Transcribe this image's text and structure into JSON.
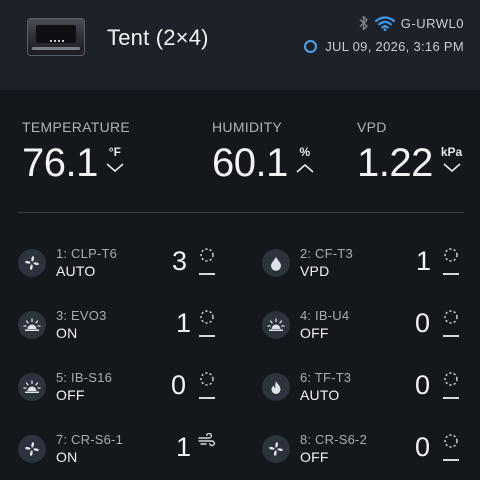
{
  "header": {
    "title": "Tent (2×4)",
    "network_name": "G-URWL0",
    "datetime": "JUL 09, 2026, 3:16 PM"
  },
  "metrics": [
    {
      "label": "TEMPERATURE",
      "value": "76.1",
      "unit": "°F",
      "trend": "down"
    },
    {
      "label": "HUMIDITY",
      "value": "60.1",
      "unit": "%",
      "trend": "up"
    },
    {
      "label": "VPD",
      "value": "1.22",
      "unit": "kPa",
      "trend": "down"
    }
  ],
  "ports": [
    {
      "name": "1: CLP-T6",
      "mode": "AUTO",
      "level": "3",
      "icon": "fan-icon",
      "status_icon": "dial-icon"
    },
    {
      "name": "2: CF-T3",
      "mode": "VPD",
      "level": "1",
      "icon": "water-drop-icon",
      "status_icon": "dial-icon"
    },
    {
      "name": "3: EVO3",
      "mode": "ON",
      "level": "1",
      "icon": "grow-light-icon",
      "status_icon": "dial-icon"
    },
    {
      "name": "4: IB-U4",
      "mode": "OFF",
      "level": "0",
      "icon": "grow-light-icon",
      "status_icon": "dial-icon"
    },
    {
      "name": "5: IB-S16",
      "mode": "OFF",
      "level": "0",
      "icon": "grow-light-icon",
      "status_icon": "dial-icon"
    },
    {
      "name": "6: TF-T3",
      "mode": "AUTO",
      "level": "0",
      "icon": "flame-icon",
      "status_icon": "dial-icon"
    },
    {
      "name": "7: CR-S6-1",
      "mode": "ON",
      "level": "1",
      "icon": "fan-icon",
      "status_icon": "wind-icon"
    },
    {
      "name": "8: CR-S6-2",
      "mode": "OFF",
      "level": "0",
      "icon": "fan-icon",
      "status_icon": "dial-icon"
    }
  ],
  "colors": {
    "background": "#14171c",
    "header_background": "#1d222a",
    "wifi": "#3b9be8",
    "status_ring": "#4aa3e8"
  }
}
